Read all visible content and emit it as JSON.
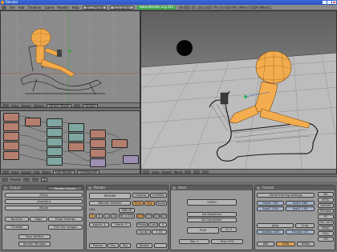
{
  "window": {
    "title": "Blender",
    "menus": [
      "File",
      "Add",
      "Timeline",
      "Game",
      "Render",
      "Help"
    ],
    "layout_field": "SR:2-Model",
    "scene_field": "SCE:Scene",
    "url": "www.blender.org 242",
    "stats": "Ve:655-35 | Ed:1425-79 | Fa:654-69 | Mem:7.42M (Mem1)"
  },
  "view_top_left": {
    "menus": [
      "View",
      "Select",
      "Object"
    ],
    "mode": "Object Mode",
    "global": "Global"
  },
  "node_editor": {
    "menus": [
      "View",
      "Select",
      "Add",
      "Node"
    ],
    "use_nodes": "Use Nodes",
    "composite": "Composite",
    "node_count": 21
  },
  "view_right": {
    "menus": [
      "View",
      "Select",
      "Mesh"
    ]
  },
  "buttons_header": {
    "menus": [
      "Panels"
    ],
    "frame": "1"
  },
  "panel_output": {
    "title": "Output",
    "tab": "Render Layers",
    "path1": "//tmp/",
    "path2": "//backbuf",
    "path3": "//ftype",
    "backbuf": "Backbuf",
    "edge": "Edge",
    "edge_settings": "Edge Settings",
    "threads": "Threads",
    "free_tex": "Free Tex Images",
    "save_buffers": "Save Buffers",
    "render_window": "Render Window"
  },
  "panel_render": {
    "title": "Render",
    "render_btn": "RENDER",
    "shadow": "Shadow",
    "envmap": "EnvMap",
    "blender_internal": "Blender Internal",
    "pano": "Pano",
    "ray": "Ray",
    "radio": "Radio",
    "osa_label": "OSA",
    "mblur": "MBLUR",
    "osa_vals": [
      "5",
      "8",
      "11",
      "16"
    ],
    "bf": "Bf: 0.500",
    "pct": [
      "100%",
      "75%",
      "50%",
      "25%"
    ],
    "xparts": "Xparts: 4",
    "yparts": "Yparts: 4",
    "fields": "Fields",
    "odd": "Odd",
    "x": "X",
    "gauss": "Gauss",
    "gauss_val": "1.00",
    "premul": "Premul",
    "key": "Key",
    "sky": "Sky",
    "border": "Border"
  },
  "panel_anim": {
    "title": "Anim",
    "video": "VIDEO",
    "do_sequence": "Do Sequence",
    "do_composite": "Do Composite",
    "play": "PLAY",
    "rt": "rt: 0",
    "sta": "Sta: 1",
    "end": "End: 250"
  },
  "panel_format": {
    "title": "Format",
    "preset": "Game framing settings",
    "sizex": "SizeX: 720",
    "sizey": "SizeY: 480",
    "aspx": "AspX: 1.00",
    "aspy": "AspY: 1.00",
    "jpg": "Jpeg",
    "crop": "Crop",
    "quality": "Quality: 100",
    "frs": "Frs/sec: 25",
    "bw": "BW",
    "rgb": "RGB",
    "rgba": "RGBA",
    "side_buttons": [
      "PAL",
      "NTSC",
      "Default",
      "Preview",
      "PC",
      "PAL 16:9",
      "PANO",
      "FULL",
      "HD"
    ]
  }
}
